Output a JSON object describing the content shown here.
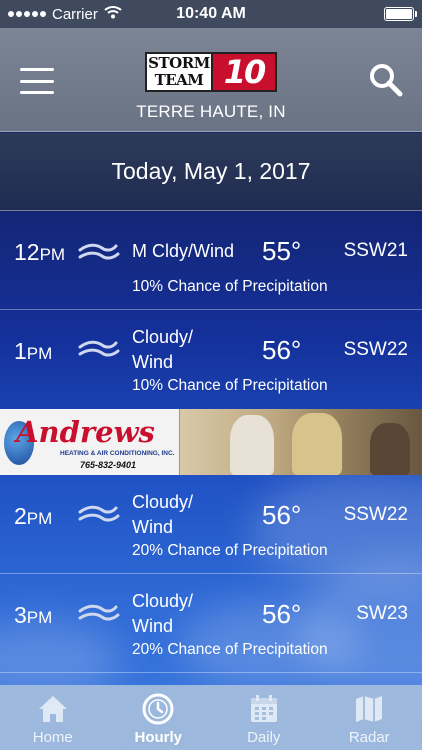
{
  "status_bar": {
    "carrier": "Carrier",
    "time": "10:40 AM"
  },
  "header": {
    "logo_line1": "STORM",
    "logo_line2": "TEAM",
    "logo_number": "10",
    "location": "TERRE HAUTE, IN"
  },
  "date_label": "Today, May 1, 2017",
  "hours": [
    {
      "time": "12",
      "ampm": "PM",
      "condition": "M Cldy/Wind",
      "temp": "55°",
      "wind": "SSW21",
      "precip": "10% Chance of Precipitation",
      "icon": "wind-icon"
    },
    {
      "time": "1",
      "ampm": "PM",
      "condition": "Cloudy/ Wind",
      "temp": "56°",
      "wind": "SSW22",
      "precip": "10% Chance of Precipitation",
      "icon": "wind-icon"
    },
    {
      "time": "2",
      "ampm": "PM",
      "condition": "Cloudy/ Wind",
      "temp": "56°",
      "wind": "SSW22",
      "precip": "20% Chance of Precipitation",
      "icon": "wind-icon"
    },
    {
      "time": "3",
      "ampm": "PM",
      "condition": "Cloudy/ Wind",
      "temp": "56°",
      "wind": "SW23",
      "precip": "20% Chance of Precipitation",
      "icon": "wind-icon"
    }
  ],
  "ad": {
    "name": "Andrews",
    "subtitle": "HEATING & AIR CONDITIONING, INC.",
    "phone": "765-832-9401"
  },
  "tabs": [
    {
      "label": "Home",
      "icon": "home-icon",
      "active": false
    },
    {
      "label": "Hourly",
      "icon": "clock-icon",
      "active": true
    },
    {
      "label": "Daily",
      "icon": "calendar-icon",
      "active": false
    },
    {
      "label": "Radar",
      "icon": "map-icon",
      "active": false
    }
  ],
  "colors": {
    "brand_red": "#c8102e",
    "header_gray": "#7c8596",
    "tab_bar": "#a5bedc"
  }
}
